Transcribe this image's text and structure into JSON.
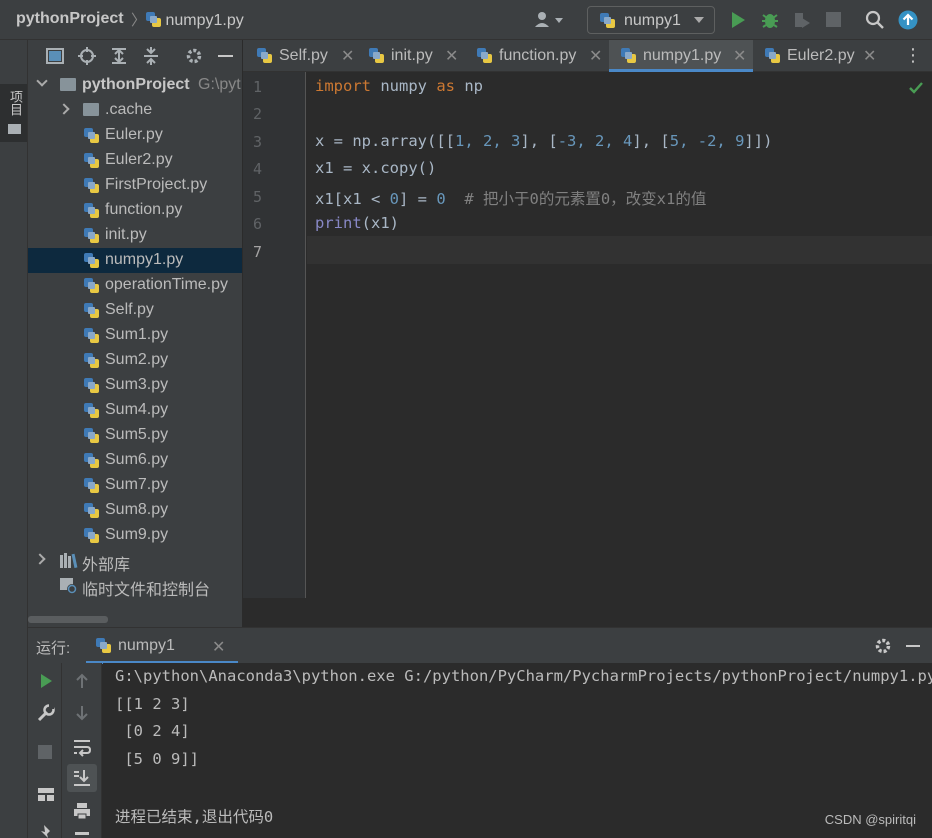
{
  "breadcrumb": {
    "project": "pythonProject",
    "file": "numpy1.py"
  },
  "toolbar": {
    "run_config": "numpy1"
  },
  "left_stripe": {
    "project_tab": "项目"
  },
  "project": {
    "root_name": "pythonProject",
    "root_path": "G:\\pyt",
    "items": [
      {
        "label": ".cache",
        "kind": "folder"
      },
      {
        "label": "Euler.py",
        "kind": "file"
      },
      {
        "label": "Euler2.py",
        "kind": "file"
      },
      {
        "label": "FirstProject.py",
        "kind": "file"
      },
      {
        "label": "function.py",
        "kind": "file"
      },
      {
        "label": "init.py",
        "kind": "file"
      },
      {
        "label": "numpy1.py",
        "kind": "file"
      },
      {
        "label": "operationTime.py",
        "kind": "file"
      },
      {
        "label": "Self.py",
        "kind": "file"
      },
      {
        "label": "Sum1.py",
        "kind": "file"
      },
      {
        "label": "Sum2.py",
        "kind": "file"
      },
      {
        "label": "Sum3.py",
        "kind": "file"
      },
      {
        "label": "Sum4.py",
        "kind": "file"
      },
      {
        "label": "Sum5.py",
        "kind": "file"
      },
      {
        "label": "Sum6.py",
        "kind": "file"
      },
      {
        "label": "Sum7.py",
        "kind": "file"
      },
      {
        "label": "Sum8.py",
        "kind": "file"
      },
      {
        "label": "Sum9.py",
        "kind": "file"
      }
    ],
    "external_libs": "外部库",
    "scratches": "临时文件和控制台"
  },
  "tabs": [
    {
      "label": "Self.py"
    },
    {
      "label": "init.py"
    },
    {
      "label": "function.py"
    },
    {
      "label": "numpy1.py"
    },
    {
      "label": "Euler2.py"
    }
  ],
  "editor": {
    "line_numbers": [
      "1",
      "2",
      "3",
      "4",
      "5",
      "6",
      "7"
    ],
    "line1": {
      "kw1": "import",
      "mod": " numpy ",
      "kw2": "as",
      "alias": " np"
    },
    "line3": {
      "a": "x = np.array([[",
      "n1": "1",
      "c1": ", ",
      "n2": "2",
      "c2": ", ",
      "n3": "3",
      "b": "], [",
      "n4": "-3",
      "c3": ", ",
      "n5": "2",
      "c4": ", ",
      "n6": "4",
      "c": "], [",
      "n7": "5",
      "c5": ", ",
      "n8": "-2",
      "c6": ", ",
      "n9": "9",
      "d": "]])"
    },
    "line4": "x1 = x.copy()",
    "line5": {
      "a": "x1[x1 < ",
      "n1": "0",
      "b": "] = ",
      "n2": "0",
      "sp": "  ",
      "comment": "# 把小于0的元素置0，改变x1的值"
    },
    "line6": {
      "fn": "print",
      "rest": "(x1)"
    }
  },
  "run": {
    "title": "运行:",
    "tab_label": "numpy1",
    "output": [
      "G:\\python\\Anaconda3\\python.exe G:/python/PyCharm/PycharmProjects/pythonProject/numpy1.py",
      "[[1 2 3]",
      " [0 2 4]",
      " [5 0 9]]",
      "",
      "进程已结束,退出代码0"
    ],
    "watermark": "CSDN @spiritqi"
  },
  "colors": {
    "accent": "#4a88c7",
    "selection": "#0d293e",
    "keyword": "#cc7832",
    "number": "#6897bb",
    "comment": "#808080",
    "builtin": "#8888c6"
  }
}
